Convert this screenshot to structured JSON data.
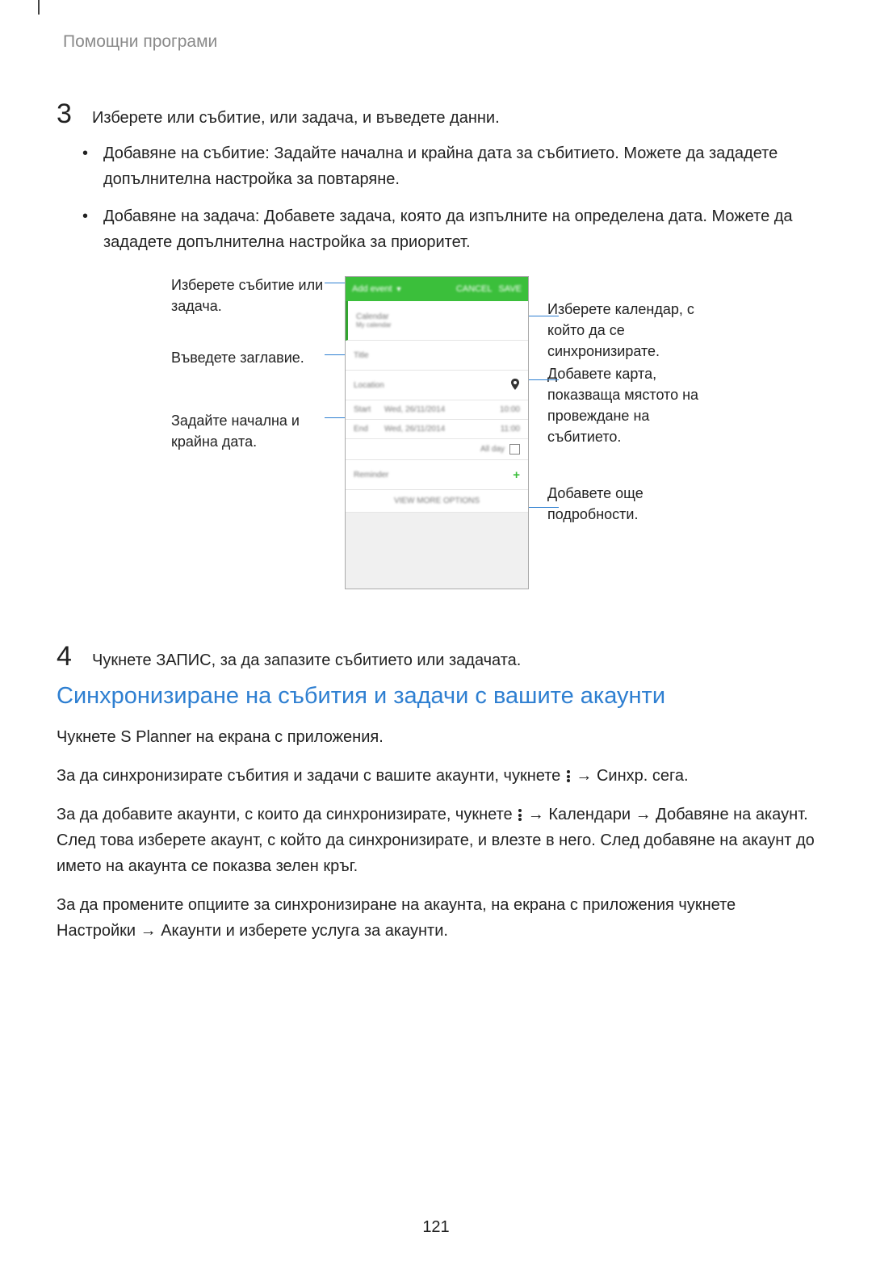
{
  "breadcrumb": "Помощни програми",
  "step3": {
    "num": "3",
    "intro": "Изберете или събитие, или задача, и въведете данни.",
    "bullet1_label": "Добавяне на събитие",
    "bullet1_text": ": Задайте начална и крайна дата за събитието. Можете да зададете допълнителна настройка за повтаряне.",
    "bullet2_label": "Добавяне на задача",
    "bullet2_text": ": Добавете задача, която да изпълните на определена дата. Можете да зададете допълнителна настройка за приоритет."
  },
  "figure": {
    "left1": "Изберете събитие или задача.",
    "left2": "Въведете заглавие.",
    "left3": "Задайте начална и крайна дата.",
    "right1": "Изберете календар, с който да се синхронизирате.",
    "right2": "Добавете карта, показваща мястото на провеждане на събитието.",
    "right3": "Добавете още подробности.",
    "phone": {
      "header_title": "Add event",
      "header_cancel": "CANCEL",
      "header_save": "SAVE",
      "cal_title": "Calendar",
      "cal_sub": "My calendar",
      "title_placeholder": "Title",
      "location_placeholder": "Location",
      "start": "Start",
      "end": "End",
      "date1": "Wed, 26/11/2014",
      "time1": "10:00",
      "date2": "Wed, 26/11/2014",
      "time2": "11:00",
      "allday": "All day",
      "reminder": "Reminder",
      "more": "VIEW MORE OPTIONS"
    }
  },
  "step4": {
    "num": "4",
    "text_pre": "Чукнете ",
    "text_bold": "ЗАПИС",
    "text_post": ", за да запазите събитието или задачата."
  },
  "sync": {
    "title": "Синхронизиране на събития и задачи с вашите акаунти",
    "p1_pre": "Чукнете ",
    "p1_bold": "S Planner",
    "p1_post": " на екрана с приложения.",
    "p2_pre": "За да синхронизирате събития и задачи с вашите акаунти, чукнете ",
    "p2_arrow": " → ",
    "p2_bold": "Синхр. сега",
    "p2_end": ".",
    "p3_pre": "За да добавите акаунти, с които да синхронизирате, чукнете ",
    "p3_b1": "Календари",
    "p3_b2": "Добавяне на акаунт",
    "p3_post": ". След това изберете акаунт, с който да синхронизирате, и влезте в него. След добавяне на акаунт до името на акаунта се показва зелен кръг.",
    "p4_pre": "За да промените опциите за синхронизиране на акаунта, на екрана с приложения чукнете ",
    "p4_b1": "Настройки",
    "p4_b2": "Акаунти",
    "p4_post": " и изберете услуга за акаунти."
  },
  "page_number": "121"
}
